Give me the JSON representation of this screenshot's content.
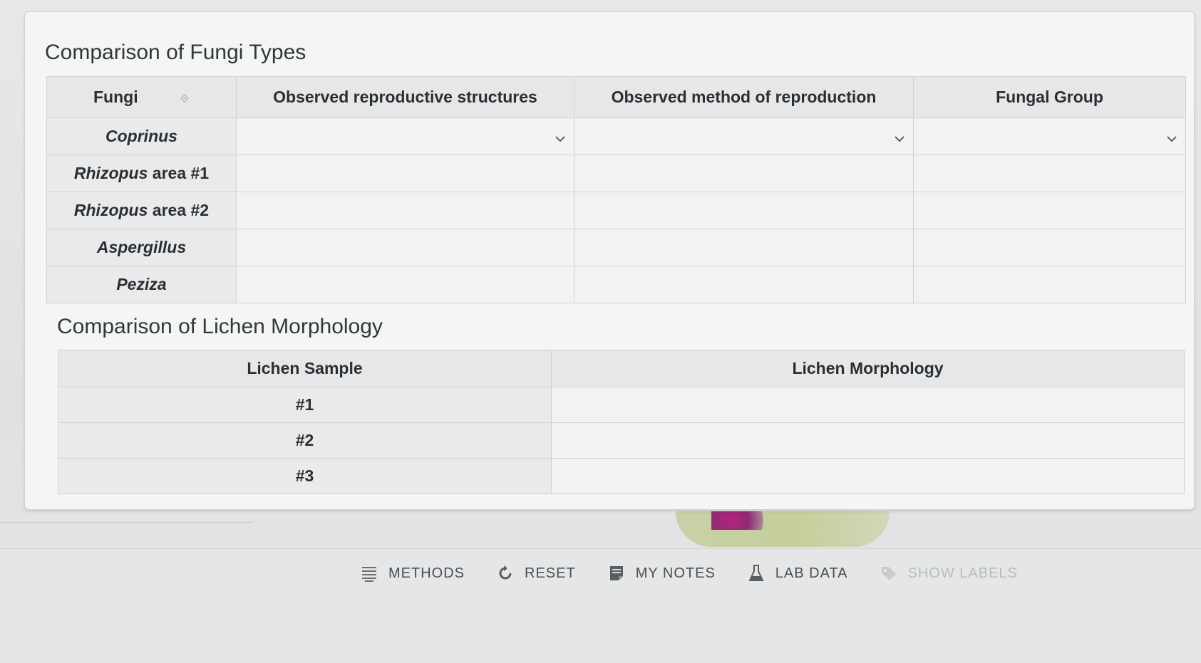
{
  "fungi": {
    "title": "Comparison of Fungi Types",
    "headers": [
      "Fungi",
      "Observed reproductive structures",
      "Observed method of reproduction",
      "Fungal Group"
    ],
    "rows": [
      {
        "name": "Coprinus",
        "suffix": "",
        "reproductive_structures": "",
        "method_of_reproduction": "",
        "fungal_group": ""
      },
      {
        "name": "Rhizopus",
        "suffix": " area #1",
        "reproductive_structures": "",
        "method_of_reproduction": "",
        "fungal_group": ""
      },
      {
        "name": "Rhizopus",
        "suffix": " area #2",
        "reproductive_structures": "",
        "method_of_reproduction": "",
        "fungal_group": ""
      },
      {
        "name": "Aspergillus",
        "suffix": "",
        "reproductive_structures": "",
        "method_of_reproduction": "",
        "fungal_group": ""
      },
      {
        "name": "Peziza",
        "suffix": "",
        "reproductive_structures": "",
        "method_of_reproduction": "",
        "fungal_group": ""
      }
    ]
  },
  "lichen": {
    "title": "Comparison of Lichen Morphology",
    "headers": [
      "Lichen Sample",
      "Lichen Morphology"
    ],
    "rows": [
      {
        "sample": "#1",
        "morphology": ""
      },
      {
        "sample": "#2",
        "morphology": ""
      },
      {
        "sample": "#3",
        "morphology": ""
      }
    ]
  },
  "toolbar": {
    "methods": "METHODS",
    "reset": "RESET",
    "my_notes": "MY NOTES",
    "lab_data": "LAB DATA",
    "show_labels": "SHOW LABELS"
  },
  "icons": {
    "sort": "sort-icon",
    "dropdown": "chevron-down-icon",
    "methods": "list-icon",
    "reset": "refresh-icon",
    "notes": "notes-icon",
    "lab": "flask-icon",
    "labels": "tag-icon"
  },
  "colors": {
    "header_bg": "#e6e7e8",
    "cell_bg": "#f1f2f2",
    "text": "#2c2f32",
    "disabled": "#b8bbbd"
  }
}
